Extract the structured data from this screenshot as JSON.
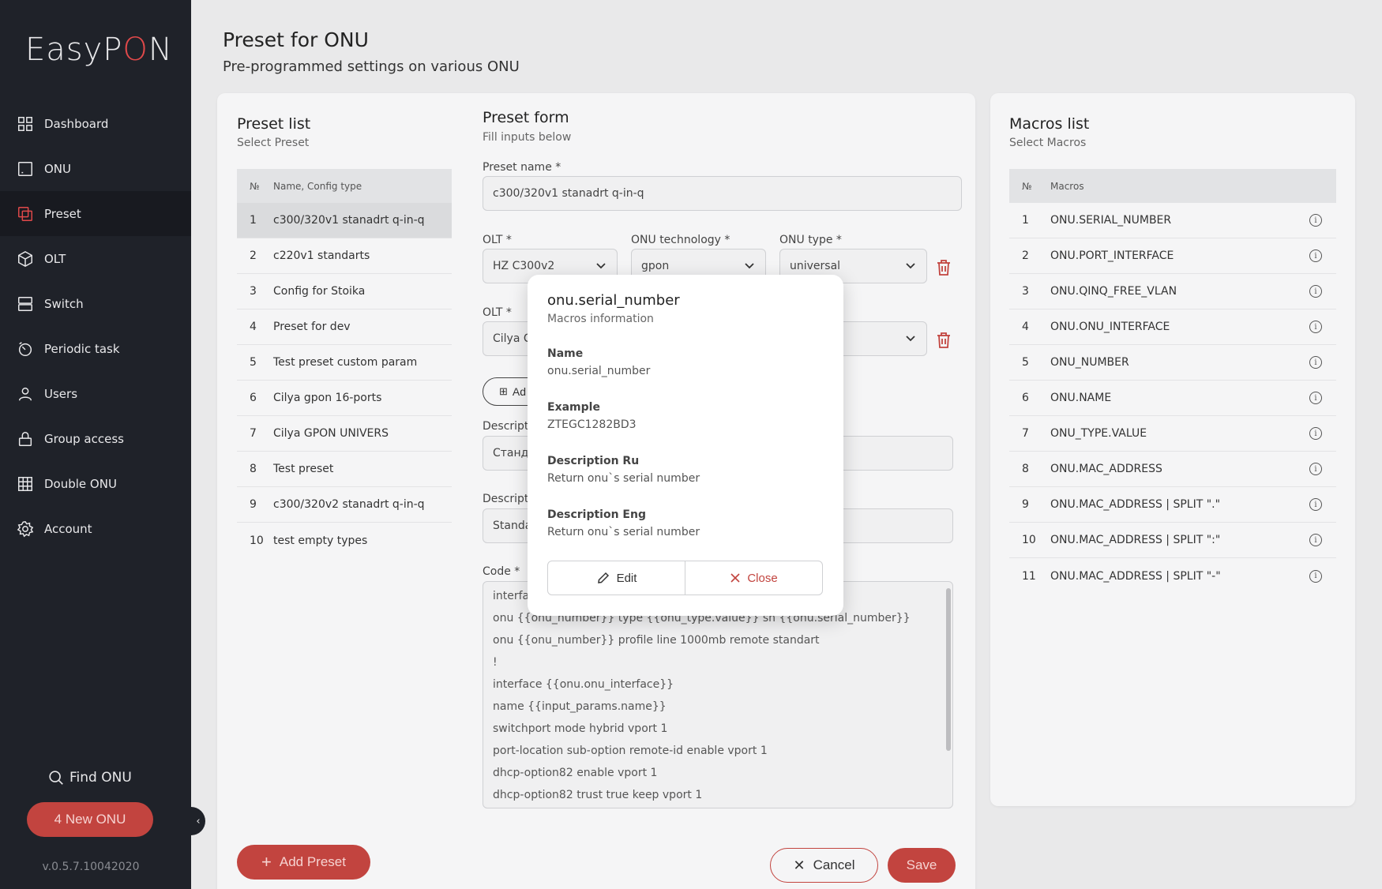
{
  "sidebar": {
    "logo_left": "EasyP",
    "logo_o": "O",
    "logo_right": "N",
    "items": [
      {
        "label": "Dashboard",
        "icon": "dashboard-icon"
      },
      {
        "label": "ONU",
        "icon": "onu-icon"
      },
      {
        "label": "Preset",
        "icon": "preset-icon",
        "active": true
      },
      {
        "label": "OLT",
        "icon": "cube-icon"
      },
      {
        "label": "Switch",
        "icon": "switch-icon"
      },
      {
        "label": "Periodic task",
        "icon": "timer-icon"
      },
      {
        "label": "Users",
        "icon": "user-icon"
      },
      {
        "label": "Group access",
        "icon": "lock-icon"
      },
      {
        "label": "Double ONU",
        "icon": "grid-icon"
      },
      {
        "label": "Account",
        "icon": "gear-icon"
      }
    ],
    "find_onu": "Find ONU",
    "new_onu": "4 New ONU",
    "version": "v.0.5.7.10042020"
  },
  "header": {
    "title": "Preset for ONU",
    "subtitle": "Pre-programmed settings on various ONU"
  },
  "preset_list": {
    "title": "Preset list",
    "subtitle": "Select Preset",
    "col_num": "№",
    "col_name": "Name, Config type",
    "rows": [
      {
        "n": "1",
        "name": "c300/320v1 stanadrt q-in-q"
      },
      {
        "n": "2",
        "name": "c220v1 standarts"
      },
      {
        "n": "3",
        "name": "Config for Stoika"
      },
      {
        "n": "4",
        "name": "Preset for dev"
      },
      {
        "n": "5",
        "name": "Test preset custom param"
      },
      {
        "n": "6",
        "name": "Cilya gpon 16-ports"
      },
      {
        "n": "7",
        "name": "Cilya GPON UNIVERS"
      },
      {
        "n": "8",
        "name": "Test preset"
      },
      {
        "n": "9",
        "name": "c300/320v2 stanadrt q-in-q"
      },
      {
        "n": "10",
        "name": "test empty types"
      }
    ],
    "add_button": "Add Preset"
  },
  "preset_form": {
    "title": "Preset form",
    "subtitle": "Fill inputs below",
    "name_label": "Preset name *",
    "name_value": "c300/320v1 stanadrt q-in-q",
    "olt_label": "OLT *",
    "olt_value": "HZ C300v2",
    "tech_label": "ONU technology *",
    "tech_value": "gpon",
    "type_label": "ONU type *",
    "type_value": "universal",
    "olt2_label": "OLT *",
    "olt2_value": "Cilya C",
    "add_label": "Ad",
    "desc_ru_label": "Descript",
    "desc_ru_value": "Станд",
    "desc_en_label": "Descript",
    "desc_en_value": "Standa",
    "code_label": "Code *",
    "code_lines": [
      "interfa",
      "onu  {{onu_number}}  type {{onu_type.value}}  sn  {{onu.serial_number}}",
      "onu {{onu_number}} profile  line 1000mb remote standart",
      "!",
      "interface  {{onu.onu_interface}}",
      "name {{input_params.name}}",
      "switchport mode hybrid vport 1",
      "port-location sub-option remote-id enable vport 1",
      "dhcp-option82 enable vport 1",
      "dhcp-option82 trust true keep vport 1"
    ],
    "cancel": "Cancel",
    "save": "Save"
  },
  "macros_list": {
    "title": "Macros list",
    "subtitle": "Select Macros",
    "col_num": "№",
    "col_name": "Macros",
    "rows": [
      {
        "n": "1",
        "name": "ONU.SERIAL_NUMBER"
      },
      {
        "n": "2",
        "name": "ONU.PORT_INTERFACE"
      },
      {
        "n": "3",
        "name": "ONU.QINQ_FREE_VLAN"
      },
      {
        "n": "4",
        "name": "ONU.ONU_INTERFACE"
      },
      {
        "n": "5",
        "name": "ONU_NUMBER"
      },
      {
        "n": "6",
        "name": "ONU.NAME"
      },
      {
        "n": "7",
        "name": "ONU_TYPE.VALUE"
      },
      {
        "n": "8",
        "name": "ONU.MAC_ADDRESS"
      },
      {
        "n": "9",
        "name": "ONU.MAC_ADDRESS | SPLIT \".\""
      },
      {
        "n": "10",
        "name": "ONU.MAC_ADDRESS | SPLIT \":\""
      },
      {
        "n": "11",
        "name": "ONU.MAC_ADDRESS | SPLIT \"-\""
      }
    ]
  },
  "modal": {
    "title": "onu.serial_number",
    "subtitle": "Macros information",
    "name_label": "Name",
    "name_value": "onu.serial_number",
    "example_label": "Example",
    "example_value": "ZTEGC1282BD3",
    "desc_ru_label": "Description Ru",
    "desc_ru_value": "Return onu`s serial number",
    "desc_en_label": "Description Eng",
    "desc_en_value": "Return onu`s serial number",
    "edit": "Edit",
    "close": "Close"
  },
  "colors": {
    "sidebar_bg": "#1f2229",
    "accent": "#c2443f",
    "background": "#e9e9ea"
  }
}
